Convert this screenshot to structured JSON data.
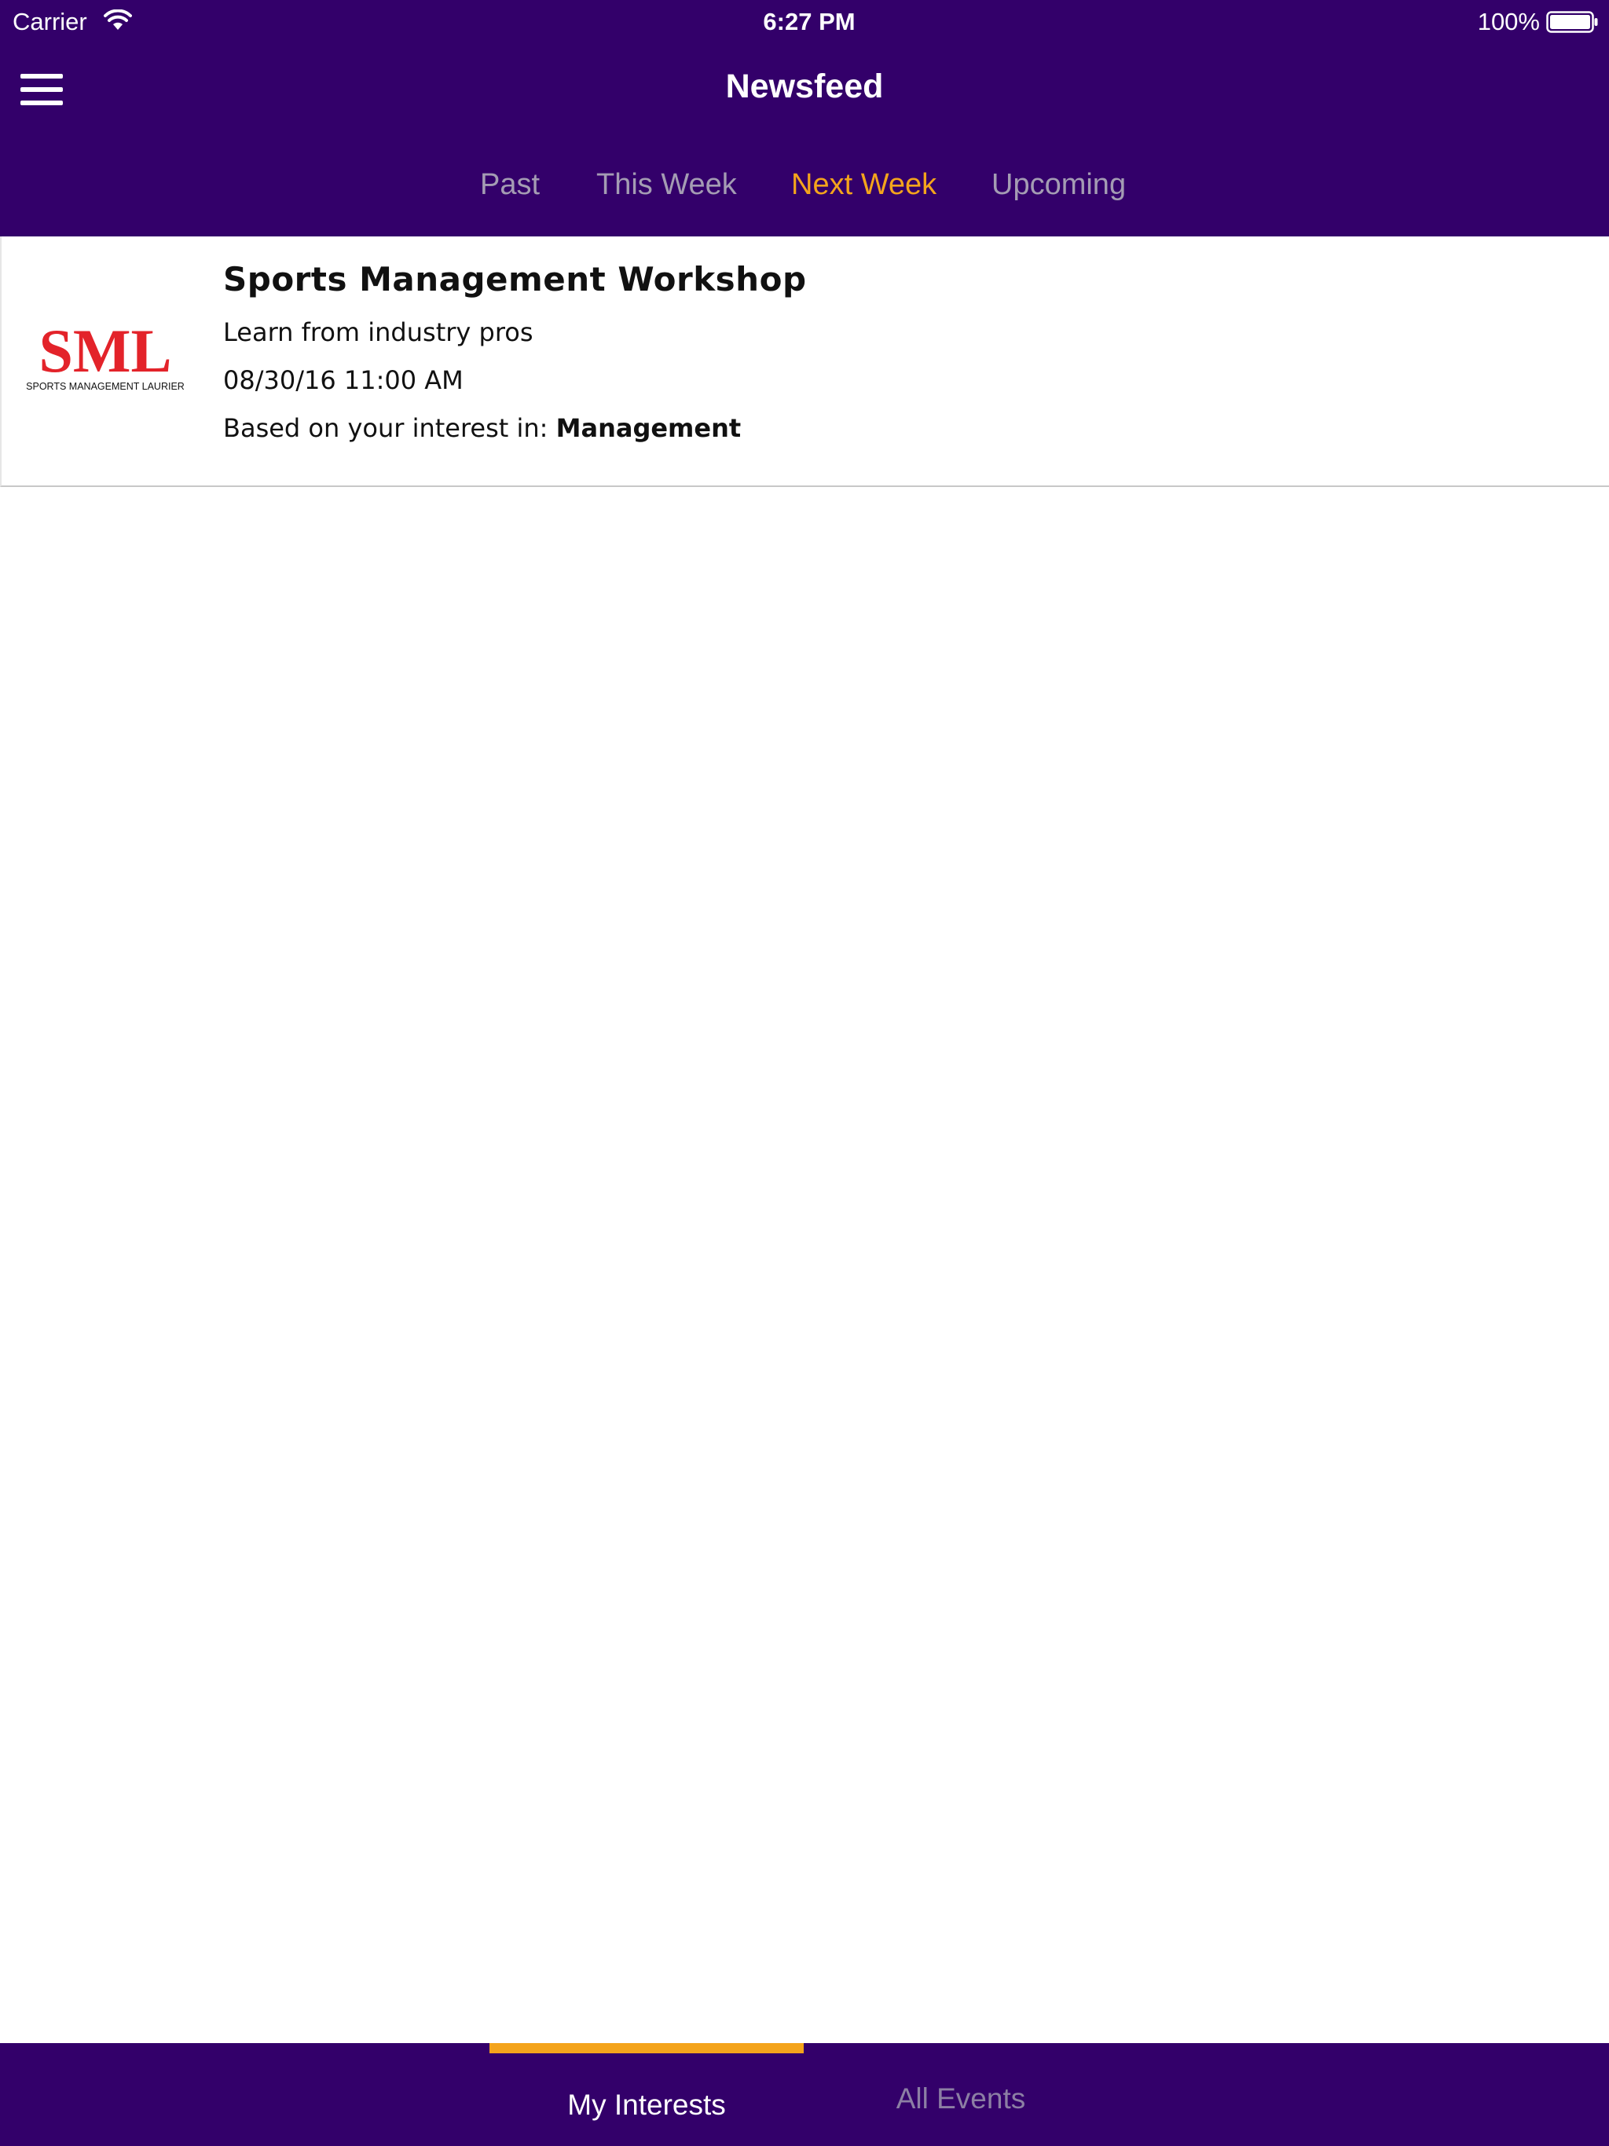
{
  "status_bar": {
    "carrier": "Carrier",
    "time": "6:27 PM",
    "battery": "100%",
    "icons": [
      "wifi-icon",
      "battery-icon"
    ]
  },
  "header": {
    "title": "Newsfeed",
    "menu_icon": "hamburger-menu-icon",
    "background_color": "#33006a"
  },
  "tabs": [
    {
      "label": "Past",
      "active": false
    },
    {
      "label": "This Week",
      "active": false
    },
    {
      "label": "Next Week",
      "active": true
    },
    {
      "label": "Upcoming",
      "active": false
    }
  ],
  "feed": {
    "items": [
      {
        "logo": {
          "text": "SML",
          "subtext": "SPORTS MANAGEMENT LAURIER"
        },
        "title": "Sports Management Workshop",
        "description": "Learn from industry pros",
        "datetime": "08/30/16 11:00 AM",
        "interest_prefix": "Based on your interest in: ",
        "interest": "Management"
      }
    ]
  },
  "bottom_tabs": [
    {
      "label": "My Interests",
      "active": true
    },
    {
      "label": "All Events",
      "active": false
    }
  ],
  "colors": {
    "brand_purple": "#33006a",
    "accent_gold": "#f4a41c",
    "inactive_tab": "#a49cb3",
    "logo_red": "#e3232a"
  }
}
